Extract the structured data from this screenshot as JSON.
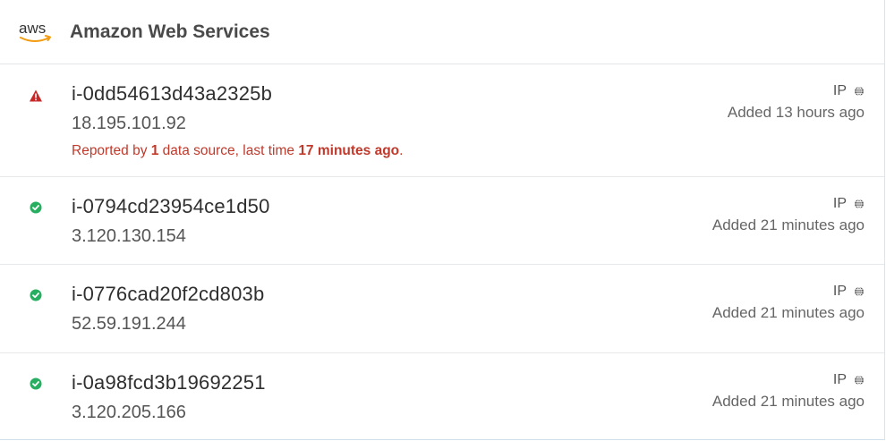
{
  "header": {
    "logo_text": "aws",
    "provider_name": "Amazon Web Services"
  },
  "instances": [
    {
      "status": "warning",
      "id": "i-0dd54613d43a2325b",
      "ip": "18.195.101.92",
      "tag": "IP",
      "added": "Added 13 hours ago",
      "report": {
        "prefix": "Reported by ",
        "count": "1",
        "middle": " data source, last time ",
        "time": "17 minutes ago",
        "suffix": "."
      }
    },
    {
      "status": "ok",
      "id": "i-0794cd23954ce1d50",
      "ip": "3.120.130.154",
      "tag": "IP",
      "added": "Added 21 minutes ago"
    },
    {
      "status": "ok",
      "id": "i-0776cad20f2cd803b",
      "ip": "52.59.191.244",
      "tag": "IP",
      "added": "Added 21 minutes ago"
    },
    {
      "status": "ok",
      "id": "i-0a98fcd3b19692251",
      "ip": "3.120.205.166",
      "tag": "IP",
      "added": "Added 21 minutes ago"
    }
  ],
  "colors": {
    "warning": "#c62828",
    "ok": "#27ae60",
    "report_text": "#c0392b",
    "aws_smile": "#f39c12"
  }
}
